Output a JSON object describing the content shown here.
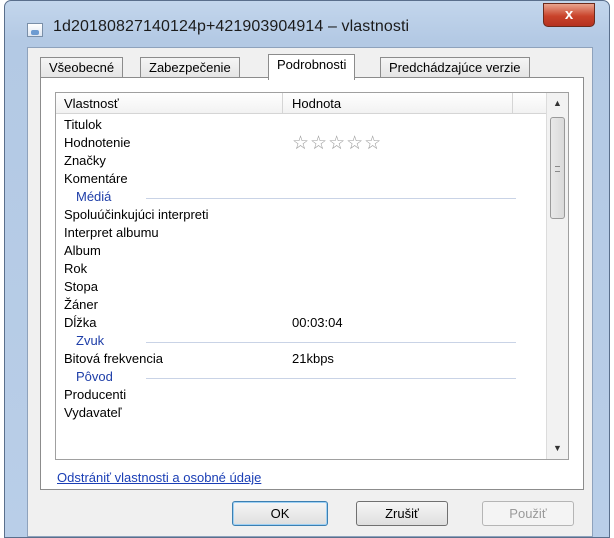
{
  "window": {
    "title": "1d20180827140124p+421903904914 – vlastnosti",
    "close_label": "x"
  },
  "tabs": [
    {
      "label": "Všeobecné"
    },
    {
      "label": "Zabezpečenie"
    },
    {
      "label": "Podrobnosti",
      "active": true
    },
    {
      "label": "Predchádzajúce verzie"
    }
  ],
  "grid": {
    "col_property": "Vlastnosť",
    "col_value": "Hodnota",
    "rows": [
      {
        "kind": "item",
        "name": "Titulok",
        "value": ""
      },
      {
        "kind": "item",
        "name": "Hodnotenie",
        "value": "",
        "rating": 0
      },
      {
        "kind": "item",
        "name": "Značky",
        "value": ""
      },
      {
        "kind": "item",
        "name": "Komentáre",
        "value": ""
      },
      {
        "kind": "group",
        "name": "Médiá"
      },
      {
        "kind": "item",
        "name": "Spoluúčinkujúci interpreti",
        "value": ""
      },
      {
        "kind": "item",
        "name": "Interpret albumu",
        "value": ""
      },
      {
        "kind": "item",
        "name": "Album",
        "value": ""
      },
      {
        "kind": "item",
        "name": "Rok",
        "value": ""
      },
      {
        "kind": "item",
        "name": "Stopa",
        "value": ""
      },
      {
        "kind": "item",
        "name": "Žáner",
        "value": ""
      },
      {
        "kind": "item",
        "name": "Dĺžka",
        "value": "00:03:04"
      },
      {
        "kind": "group",
        "name": "Zvuk"
      },
      {
        "kind": "item",
        "name": "Bitová frekvencia",
        "value": "21kbps"
      },
      {
        "kind": "group",
        "name": "Pôvod"
      },
      {
        "kind": "item",
        "name": "Producenti",
        "value": ""
      },
      {
        "kind": "item",
        "name": "Vydavateľ",
        "value": ""
      }
    ]
  },
  "link": {
    "remove_props": "Odstrániť vlastnosti a osobné údaje"
  },
  "buttons": {
    "ok": "OK",
    "cancel": "Zrušiť",
    "apply": "Použiť"
  }
}
